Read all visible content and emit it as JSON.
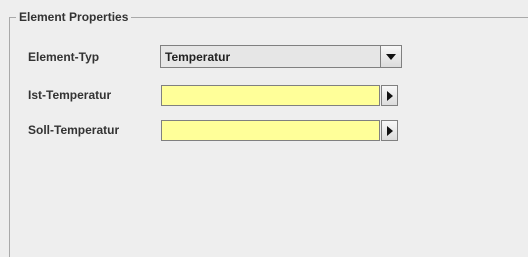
{
  "panel": {
    "title": "Element Properties"
  },
  "fields": {
    "element_type": {
      "label": "Element-Typ",
      "value": "Temperatur"
    },
    "ist_temperatur": {
      "label": "Ist-Temperatur",
      "value": ""
    },
    "soll_temperatur": {
      "label": "Soll-Temperatur",
      "value": ""
    }
  },
  "icons": {
    "dropdown": "chevron-down-icon",
    "arrow": "arrow-right-icon"
  },
  "colors": {
    "field_bg": "#ffff99",
    "panel_bg": "#eeeeee"
  }
}
